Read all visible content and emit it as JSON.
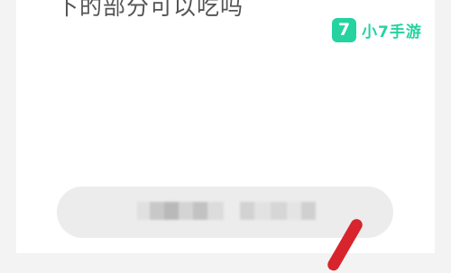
{
  "post": {
    "heading_text": "下的部分可以吃吗"
  },
  "watermark": {
    "badge_glyph": "7",
    "brand_text": "小7手游",
    "brand_color": "#24d3a0"
  },
  "comment_area": {
    "state": "obscured",
    "tile_colors": {
      "dark": "#bdbdbd",
      "mid": "#d0d0d0",
      "light": "#e0e0e0"
    }
  },
  "pen_cursor": {
    "icon": "red-pen-icon",
    "color": "#d8242c"
  }
}
